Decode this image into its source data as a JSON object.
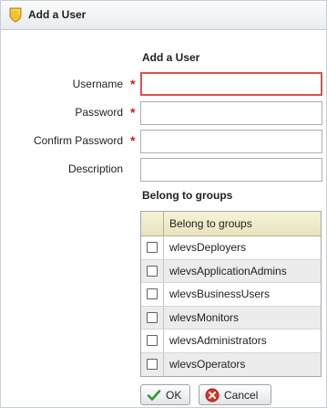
{
  "dialog": {
    "title": "Add a User"
  },
  "form": {
    "heading": "Add a User",
    "required_marker": "*",
    "fields": [
      {
        "label": "Username",
        "value": "",
        "required": true
      },
      {
        "label": "Password",
        "value": "",
        "required": true
      },
      {
        "label": "Confirm Password",
        "value": "",
        "required": true
      },
      {
        "label": "Description",
        "value": "",
        "required": false
      }
    ]
  },
  "groups": {
    "heading": "Belong to groups",
    "column_header": "Belong to groups",
    "items": [
      {
        "name": "wlevsDeployers",
        "checked": false
      },
      {
        "name": "wlevsApplicationAdmins",
        "checked": false
      },
      {
        "name": "wlevsBusinessUsers",
        "checked": false
      },
      {
        "name": "wlevsMonitors",
        "checked": false
      },
      {
        "name": "wlevsAdministrators",
        "checked": false
      },
      {
        "name": "wlevsOperators",
        "checked": false
      }
    ]
  },
  "buttons": {
    "ok": "OK",
    "cancel": "Cancel"
  },
  "icons": {
    "title": "shield-icon",
    "ok": "checkmark-icon",
    "cancel": "cancel-icon"
  },
  "colors": {
    "required": "#cc1f1f",
    "focus_border": "#e04e4e",
    "header_row": "#efe9c8",
    "alt_row": "#ececec"
  }
}
